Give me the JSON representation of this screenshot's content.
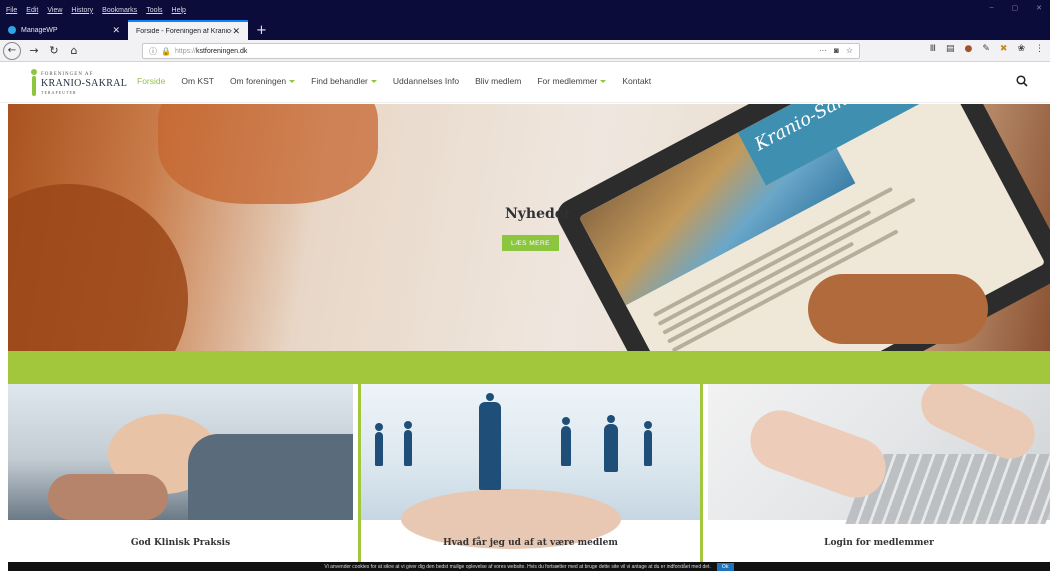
{
  "browser": {
    "menu": [
      "File",
      "Edit",
      "View",
      "History",
      "Bookmarks",
      "Tools",
      "Help"
    ],
    "window_controls": [
      "–",
      "▢",
      "✕"
    ],
    "tabs": [
      {
        "label": "ManageWP",
        "close": "✕"
      },
      {
        "label": "Forside - Foreningen af Kranio-Sak",
        "close": "✕"
      }
    ],
    "new_tab": "+",
    "url_secure": "https://",
    "url_host": "kstforeningen.dk",
    "page_actions": "···",
    "icons": [
      "library-icon",
      "sidebar-icon",
      "extension-icon",
      "pen-icon",
      "tools-icon",
      "addon-icon",
      "more-icon"
    ]
  },
  "site": {
    "logo": {
      "line1": "FORENINGEN AF",
      "line2": "KRANIO-SAKRAL",
      "line3": "TERAPEUTER"
    },
    "nav": [
      {
        "label": "Forside",
        "active": true,
        "dropdown": false
      },
      {
        "label": "Om KST",
        "active": false,
        "dropdown": false
      },
      {
        "label": "Om foreningen",
        "active": false,
        "dropdown": true
      },
      {
        "label": "Find behandler",
        "active": false,
        "dropdown": true
      },
      {
        "label": "Uddannelses Info",
        "active": false,
        "dropdown": false
      },
      {
        "label": "Bliv medlem",
        "active": false,
        "dropdown": false
      },
      {
        "label": "For medlemmer",
        "active": false,
        "dropdown": true
      },
      {
        "label": "Kontakt",
        "active": false,
        "dropdown": false
      }
    ],
    "hero": {
      "title": "Nyheder",
      "button": "LÆS MERE",
      "tablet_title": "Kranio-Sakral Terapi"
    },
    "cards": [
      {
        "title": "God Klinisk Praksis"
      },
      {
        "title": "Hvad får jeg ud af at være medlem"
      },
      {
        "title": "Login for medlemmer"
      }
    ],
    "cookie": {
      "text": "Vi anvender cookies for at sikre at vi giver dig den bedst mulige oplevelse af vores website. Hvis du fortsætter med at bruge dette site vil vi antage at du er indforstået med det.",
      "ok": "Ok"
    }
  },
  "colors": {
    "accent_green": "#8cc63f",
    "green_bar": "#a3c73c",
    "chrome_dark": "#0c0c3a",
    "figure_blue": "#1f4f79"
  }
}
